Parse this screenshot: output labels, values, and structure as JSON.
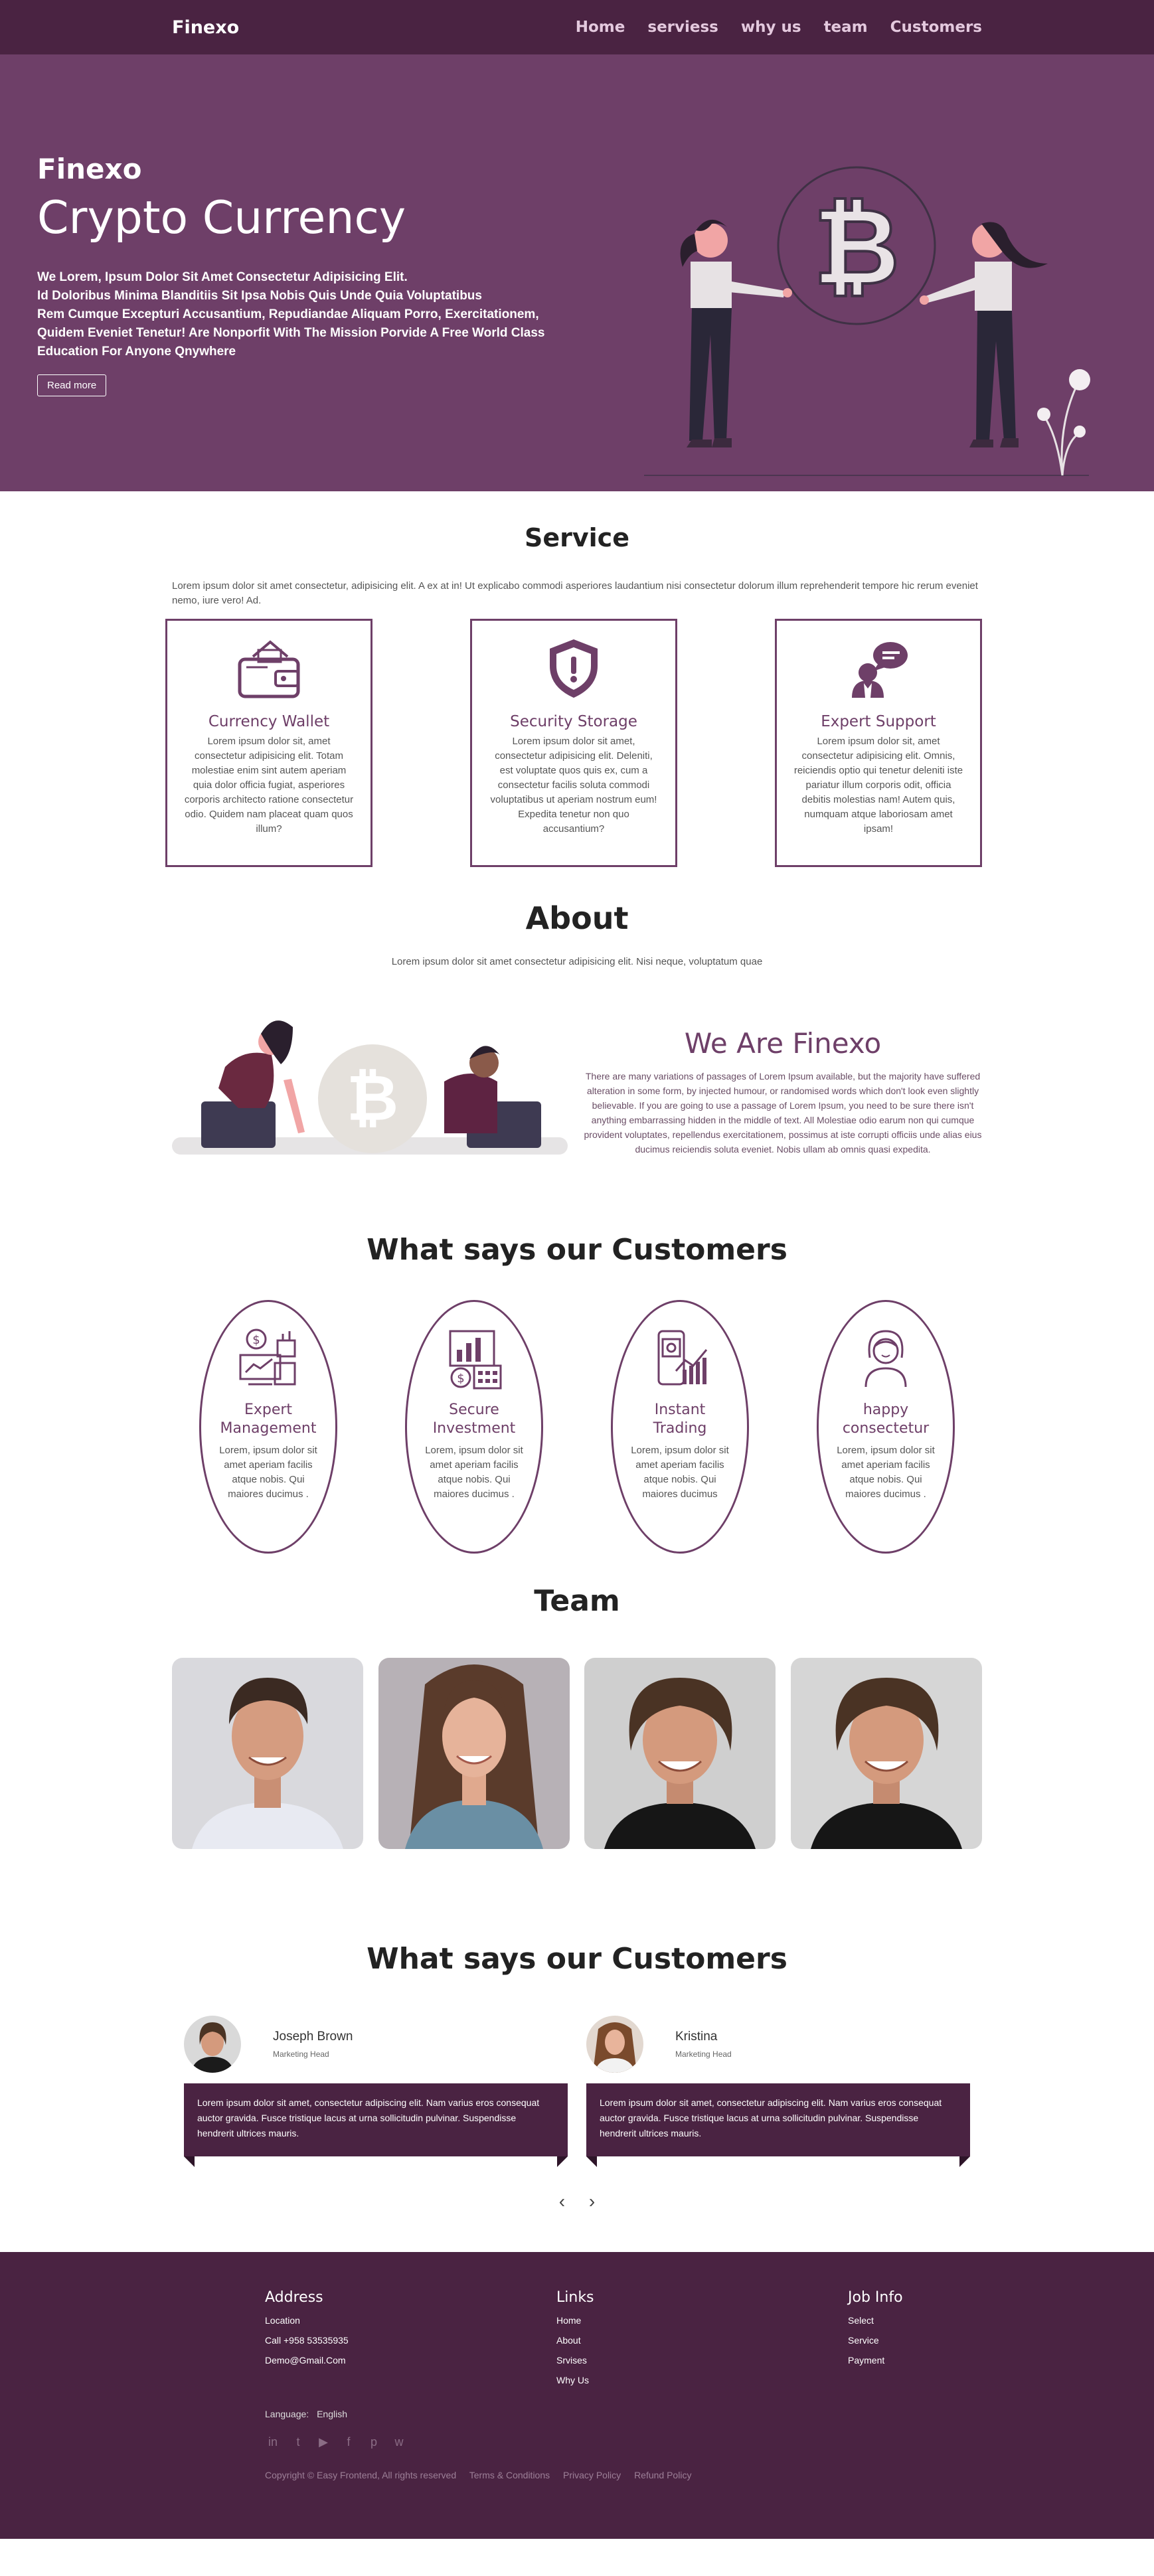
{
  "nav": {
    "brand": "Finexo",
    "items": [
      "Home",
      "serviess",
      "why us",
      "team",
      "Customers"
    ]
  },
  "hero": {
    "subtitle": "Finexo",
    "title": "Crypto Currency",
    "text": "We Lorem, Ipsum Dolor Sit Amet Consectetur Adipisicing Elit.\nId Doloribus Minima Blanditiis Sit Ipsa Nobis Quis Unde Quia Voluptatibus\nRem Cumque Excepturi Accusantium, Repudiandae Aliquam Porro, Exercitationem,\nQuidem Eveniet Tenetur! Are Nonporfit With The Mission Porvide A Free World Class\nEducation For Anyone Qnywhere",
    "button": "Read more"
  },
  "service": {
    "title": "Service",
    "intro": "Lorem ipsum dolor sit amet consectetur, adipisicing elit. A ex at in! Ut explicabo commodi asperiores laudantium nisi consectetur dolorum illum reprehenderit tempore hic rerum eveniet nemo, iure vero! Ad.",
    "cards": [
      {
        "icon": "wallet-icon",
        "title": "Currency Wallet",
        "text": "Lorem ipsum dolor sit, amet consectetur adipisicing elit. Totam molestiae enim sint autem aperiam quia dolor officia fugiat, asperiores corporis architecto ratione consectetur odio. Quidem nam placeat quam quos illum?"
      },
      {
        "icon": "shield-icon",
        "title": "Security Storage",
        "text": "Lorem ipsum dolor sit amet, consectetur adipisicing elit. Deleniti, est voluptate quos quis ex, cum a consectetur facilis soluta commodi voluptatibus ut aperiam nostrum eum! Expedita tenetur non quo accusantium?"
      },
      {
        "icon": "support-icon",
        "title": "Expert Support",
        "text": "Lorem ipsum dolor sit, amet consectetur adipisicing elit. Omnis, reiciendis optio qui tenetur deleniti iste pariatur illum corporis odit, officia debitis molestias nam! Autem quis, numquam atque laboriosam amet ipsam!"
      }
    ]
  },
  "about": {
    "title": "About",
    "intro": "Lorem ipsum dolor sit amet consectetur adipisicing elit. Nisi neque, voluptatum quae",
    "heading": "We Are Finexo",
    "text": "There are many variations of passages of Lorem Ipsum available, but the majority have suffered alteration in some form, by injected humour, or randomised words which don't look even slightly believable. If you are going to use a passage of Lorem Ipsum, you need to be sure there isn't anything embarrassing hidden in the middle of text. All Molestiae odio earum non qui cumque provident voluptates, repellendus exercitationem, possimus at iste corrupti officiis unde alias eius ducimus reiciendis soluta eveniet. Nobis ullam ab omnis quasi expedita."
  },
  "customers": {
    "title": "What says our Customers",
    "items": [
      {
        "icon": "management-icon",
        "title": "Expert\nManagement",
        "text": "Lorem, ipsum dolor sit amet aperiam facilis atque nobis. Qui maiores ducimus ."
      },
      {
        "icon": "investment-icon",
        "title": "Secure\nInvestment",
        "text": "Lorem, ipsum dolor sit amet aperiam facilis atque nobis. Qui maiores ducimus ."
      },
      {
        "icon": "trading-icon",
        "title": "Instant\nTrading",
        "text": "Lorem, ipsum dolor sit amet aperiam facilis atque nobis. Qui maiores ducimus"
      },
      {
        "icon": "happy-user-icon",
        "title": "happy\nconsectetur",
        "text": "Lorem, ipsum dolor sit amet aperiam facilis atque nobis. Qui maiores ducimus ."
      }
    ]
  },
  "team": {
    "title": "Team"
  },
  "testimonials": {
    "title": "What says our Customers",
    "items": [
      {
        "name": "Joseph Brown",
        "role": "Marketing Head",
        "text": "Lorem ipsum dolor sit amet, consectetur adipiscing elit. Nam varius eros consequat auctor gravida. Fusce tristique lacus at urna sollicitudin pulvinar. Suspendisse hendrerit ultrices mauris."
      },
      {
        "name": "Kristina",
        "role": "Marketing Head",
        "text": "Lorem ipsum dolor sit amet, consectetur adipiscing elit. Nam varius eros consequat auctor gravida. Fusce tristique lacus at urna sollicitudin pulvinar. Suspendisse hendrerit ultrices mauris."
      }
    ],
    "prev": "‹",
    "next": "›"
  },
  "footer": {
    "address_title": "Address",
    "address": [
      "Location",
      "Call +958 53535935",
      "Demo@Gmail.Com"
    ],
    "links_title": "Links",
    "links": [
      "Home",
      "About",
      "Srvises",
      "Why Us"
    ],
    "job_title": "Job Info",
    "job": [
      "Select",
      "Service",
      "Payment"
    ],
    "language_label": "Language:",
    "language": "English",
    "copyright": "Copyright © Easy Frontend, All rights reserved",
    "legal": [
      "Terms & Conditions",
      "Privacy Policy",
      "Refund Policy"
    ]
  }
}
